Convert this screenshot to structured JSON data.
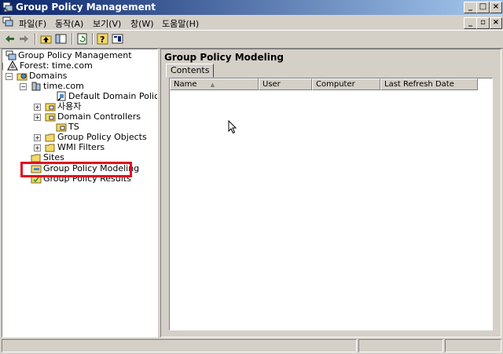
{
  "window": {
    "title": "Group Policy Management",
    "controls": {
      "minimize": "_",
      "restore": "□",
      "close": "×"
    },
    "child_controls": {
      "minimize": "_",
      "restore": "▫",
      "close": "×"
    },
    "accent": "#0a246a",
    "app_icon": "gpmc-icon"
  },
  "menubar": {
    "items": [
      {
        "label": "파일(F)"
      },
      {
        "label": "동작(A)"
      },
      {
        "label": "보기(V)"
      },
      {
        "label": "창(W)"
      },
      {
        "label": "도움말(H)"
      }
    ]
  },
  "toolbar": {
    "buttons": [
      {
        "icon": "back-arrow-icon"
      },
      {
        "icon": "forward-arrow-icon"
      },
      {
        "icon": "up-folder-icon"
      },
      {
        "icon": "show-hide-tree-icon"
      },
      {
        "icon": "refresh-icon"
      },
      {
        "icon": "help-icon"
      },
      {
        "icon": "properties-icon"
      }
    ]
  },
  "tree": {
    "nodes": [
      {
        "label": "Group Policy Management",
        "icon": "gpmc-icon"
      },
      {
        "label": "Forest: time.com",
        "icon": "forest-icon"
      },
      {
        "label": "Domains",
        "icon": "domains-icon"
      },
      {
        "label": "time.com",
        "icon": "domain-icon"
      },
      {
        "label": "Default Domain Policy",
        "icon": "gpo-link-icon"
      },
      {
        "label": "사용자",
        "icon": "ou-folder-icon"
      },
      {
        "label": "Domain Controllers",
        "icon": "ou-folder-icon"
      },
      {
        "label": "TS",
        "icon": "ou-folder-icon"
      },
      {
        "label": "Group Policy Objects",
        "icon": "folder-icon"
      },
      {
        "label": "WMI Filters",
        "icon": "folder-icon"
      },
      {
        "label": "Sites",
        "icon": "folder-icon"
      },
      {
        "label": "Group Policy Modeling",
        "icon": "modeling-icon"
      },
      {
        "label": "Group Policy Results",
        "icon": "results-icon"
      }
    ],
    "highlight_color": "#e01020"
  },
  "rightpane": {
    "title": "Group Policy Modeling",
    "tab": "Contents",
    "columns": [
      {
        "label": "Name",
        "sort_indicator": "▲"
      },
      {
        "label": "User"
      },
      {
        "label": "Computer"
      },
      {
        "label": "Last Refresh Date"
      }
    ]
  }
}
